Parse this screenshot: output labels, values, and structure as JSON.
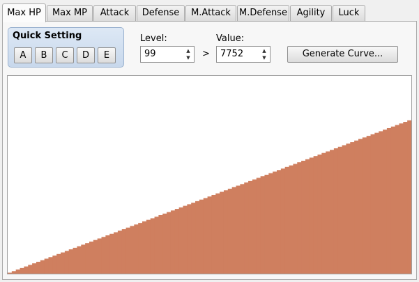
{
  "tabs": [
    {
      "label": "Max HP",
      "active": true
    },
    {
      "label": "Max MP",
      "active": false
    },
    {
      "label": "Attack",
      "active": false
    },
    {
      "label": "Defense",
      "active": false
    },
    {
      "label": "M.Attack",
      "active": false
    },
    {
      "label": "M.Defense",
      "active": false
    },
    {
      "label": "Agility",
      "active": false
    },
    {
      "label": "Luck",
      "active": false
    }
  ],
  "quick_setting": {
    "title": "Quick Setting",
    "buttons": [
      "A",
      "B",
      "C",
      "D",
      "E"
    ]
  },
  "level": {
    "label": "Level:",
    "value": "99"
  },
  "comparator": ">",
  "value": {
    "label": "Value:",
    "value": "7752"
  },
  "generate_button": "Generate Curve...",
  "graph": {
    "fill_color": "#cf7f5f",
    "background": "#ffffff",
    "min_level": 1,
    "max_level": 99,
    "start_value": 50,
    "end_value": 7752,
    "display_max": 9999
  }
}
